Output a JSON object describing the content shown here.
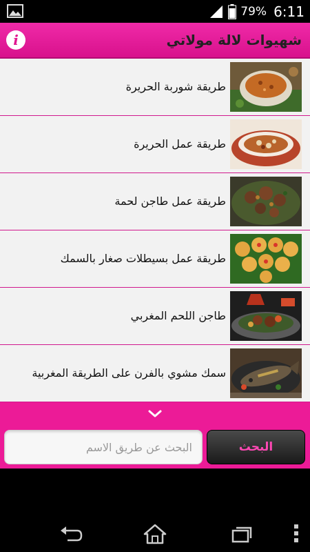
{
  "status_bar": {
    "battery_percent": "79%",
    "time": "6:11",
    "icons": [
      "gallery-notification-icon",
      "signal-icon",
      "battery-icon"
    ]
  },
  "header": {
    "title": "شهيوات لالة مولاتي",
    "info_icon": "i"
  },
  "recipes": [
    {
      "title": "طريقة شوربة الحريرة",
      "thumb": "harira-soup-image"
    },
    {
      "title": "طريقة عمل الحريرة",
      "thumb": "harira-bowl-image"
    },
    {
      "title": "طريقة عمل طاجن لحمة",
      "thumb": "meat-tagine-image"
    },
    {
      "title": "طريقة عمل بسيطلات صغار بالسمك",
      "thumb": "fish-pastillas-image"
    },
    {
      "title": "طاجن اللحم المغربي",
      "thumb": "moroccan-meat-tagine-image"
    },
    {
      "title": "سمك مشوي بالفرن على الطريقة المغربية",
      "thumb": "baked-fish-image"
    }
  ],
  "search": {
    "placeholder": "البحث عن طريق الاسم",
    "value": "",
    "button_label": "البحث"
  },
  "colors": {
    "accent": "#ec1b97",
    "list_background": "#f2f2f2",
    "search_button_text": "#ff48b4"
  }
}
